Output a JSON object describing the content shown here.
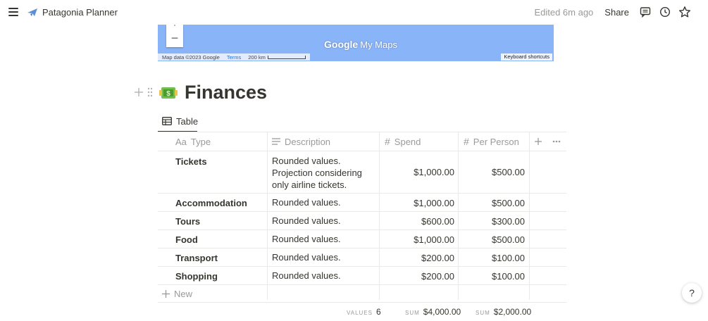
{
  "topbar": {
    "page_name": "Patagonia Planner",
    "edited": "Edited 6m ago",
    "share_label": "Share"
  },
  "map": {
    "brand_google": "Google",
    "brand_mymaps": "My Maps",
    "map_data": "Map data ©2023 Google",
    "terms": "Terms",
    "scale": "200 km",
    "keyboard_shortcuts": "Keyboard shortcuts"
  },
  "page": {
    "title": "Finances",
    "title_emoji": "money-with-wings"
  },
  "tabs": [
    {
      "label": "Table",
      "icon": "table-icon"
    }
  ],
  "table": {
    "columns": [
      {
        "label": "Type",
        "prefix": "Aa"
      },
      {
        "label": "Description",
        "icon": "text-lines-icon"
      },
      {
        "label": "Spend",
        "icon": "number-hash-icon"
      },
      {
        "label": "Per Person",
        "icon": "number-hash-icon"
      }
    ],
    "rows": [
      {
        "type": "Tickets",
        "description": "Rounded values. Projection considering only airline tickets.",
        "spend": "$1,000.00",
        "per_person": "$500.00"
      },
      {
        "type": "Accommodation",
        "description": "Rounded values.",
        "spend": "$1,000.00",
        "per_person": "$500.00"
      },
      {
        "type": "Tours",
        "description": "Rounded values.",
        "spend": "$600.00",
        "per_person": "$300.00"
      },
      {
        "type": "Food",
        "description": "Rounded values.",
        "spend": "$1,000.00",
        "per_person": "$500.00"
      },
      {
        "type": "Transport",
        "description": "Rounded values.",
        "spend": "$200.00",
        "per_person": "$100.00"
      },
      {
        "type": "Shopping",
        "description": "Rounded values.",
        "spend": "$200.00",
        "per_person": "$100.00"
      }
    ],
    "new_label": "New",
    "calc": {
      "values_label": "VALUES",
      "values_count": "6",
      "spend_label": "SUM",
      "spend_sum": "$4,000.00",
      "pp_label": "SUM",
      "pp_sum": "$2,000.00"
    }
  },
  "help_label": "?",
  "colors": {
    "accent": "#37352f",
    "muted": "#9b9a97",
    "map": "#8ab4f8"
  }
}
